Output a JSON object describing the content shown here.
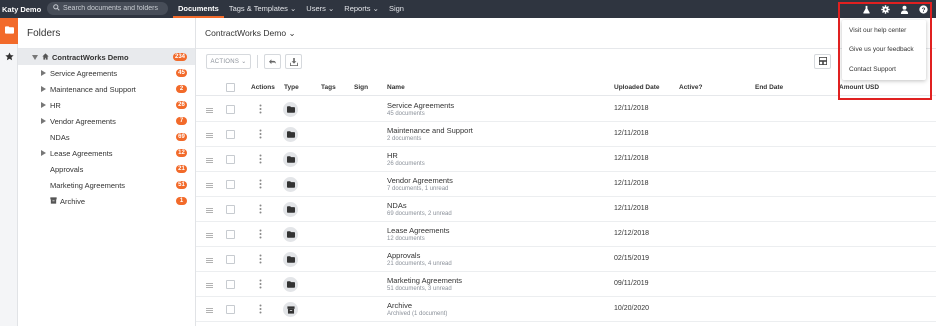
{
  "nav": {
    "user": "Katy Demo",
    "search_placeholder": "Search documents and folders",
    "links": [
      "Documents",
      "Tags & Templates",
      "Users",
      "Reports",
      "Sign"
    ]
  },
  "icons": {
    "search": "search-icon",
    "beaker": "beaker-icon",
    "gear": "gear-icon",
    "user": "user-icon",
    "help": "help-icon",
    "folder": "folder-icon",
    "star": "star-icon",
    "undo": "undo-icon",
    "download": "download-icon",
    "grid": "grid-view-icon",
    "archive": "archive-box-icon",
    "home": "home-icon"
  },
  "colors": {
    "accent": "#f26a2a",
    "nav_bg": "#2f3540",
    "highlight": "#e02020"
  },
  "folders": {
    "title": "Folders",
    "root": {
      "label": "ContractWorks Demo",
      "count": "234"
    },
    "items": [
      {
        "label": "Service Agreements",
        "count": "45",
        "expandable": true
      },
      {
        "label": "Maintenance and Support",
        "count": "2",
        "expandable": true
      },
      {
        "label": "HR",
        "count": "26",
        "expandable": true
      },
      {
        "label": "Vendor Agreements",
        "count": "7",
        "expandable": true
      },
      {
        "label": "NDAs",
        "count": "69",
        "expandable": false
      },
      {
        "label": "Lease Agreements",
        "count": "12",
        "expandable": true
      },
      {
        "label": "Approvals",
        "count": "21",
        "expandable": false
      },
      {
        "label": "Marketing Agreements",
        "count": "51",
        "expandable": false
      },
      {
        "label": "Archive",
        "count": "1",
        "expandable": false
      }
    ]
  },
  "main": {
    "title": "ContractWorks Demo",
    "actions_label": "ACTIONS",
    "columns": [
      "Actions",
      "Type",
      "Tags",
      "Sign",
      "Name",
      "Uploaded Date",
      "Active?",
      "End Date",
      "Amount USD"
    ],
    "rows": [
      {
        "name": "Service Agreements",
        "sub": "45 documents",
        "date": "12/11/2018"
      },
      {
        "name": "Maintenance and Support",
        "sub": "2 documents",
        "date": "12/11/2018"
      },
      {
        "name": "HR",
        "sub": "26 documents",
        "date": "12/11/2018"
      },
      {
        "name": "Vendor Agreements",
        "sub": "7 documents, 1 unread",
        "date": "12/11/2018"
      },
      {
        "name": "NDAs",
        "sub": "69 documents, 2 unread",
        "date": "12/11/2018"
      },
      {
        "name": "Lease Agreements",
        "sub": "12 documents",
        "date": "12/12/2018"
      },
      {
        "name": "Approvals",
        "sub": "21 documents, 4 unread",
        "date": "02/15/2019"
      },
      {
        "name": "Marketing Agreements",
        "sub": "51 documents, 3 unread",
        "date": "09/11/2019"
      },
      {
        "name": "Archive",
        "sub": "Archived (1 document)",
        "date": "10/20/2020"
      }
    ]
  },
  "help_menu": {
    "items": [
      "Visit our help center",
      "Give us your feedback",
      "Contact Support"
    ]
  }
}
